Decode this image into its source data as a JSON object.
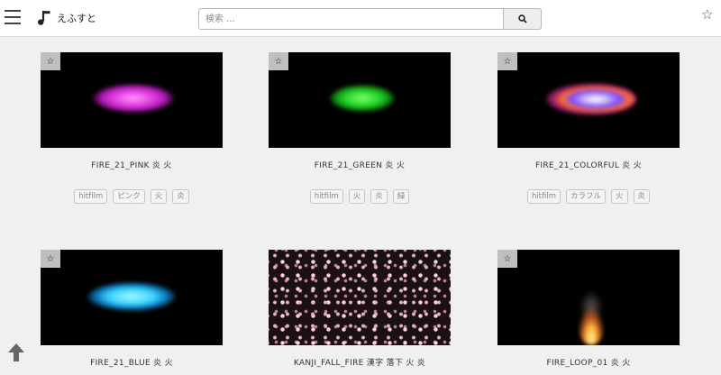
{
  "header": {
    "brand": "えふすと",
    "search": {
      "placeholder": "検索 ..."
    }
  },
  "icons": {
    "menu": "hamburger-icon",
    "logo": "music-note-logo-icon",
    "search": "magnifier-icon",
    "favorite": "star-icon",
    "back_to_top": "arrow-up-icon"
  },
  "cards": [
    {
      "title": "FIRE_21_PINK 炎 火",
      "tags": [
        "hitfilm",
        "ピンク",
        "火",
        "炎"
      ]
    },
    {
      "title": "FIRE_21_GREEN 炎 火",
      "tags": [
        "hitfilm",
        "火",
        "炎",
        "緑"
      ]
    },
    {
      "title": "FIRE_21_COLORFUL 炎 火",
      "tags": [
        "hitfilm",
        "カラフル",
        "火",
        "炎"
      ]
    },
    {
      "title": "FIRE_21_BLUE 炎 火",
      "tags": []
    },
    {
      "title": "KANJI_FALL_FIRE 漢字 落下 火 炎",
      "tags": []
    },
    {
      "title": "FIRE_LOOP_01 炎 火",
      "tags": []
    }
  ],
  "colors": {
    "accent": "#444444",
    "tag_border": "#c6c6c6",
    "background": "#f0f0f0"
  }
}
